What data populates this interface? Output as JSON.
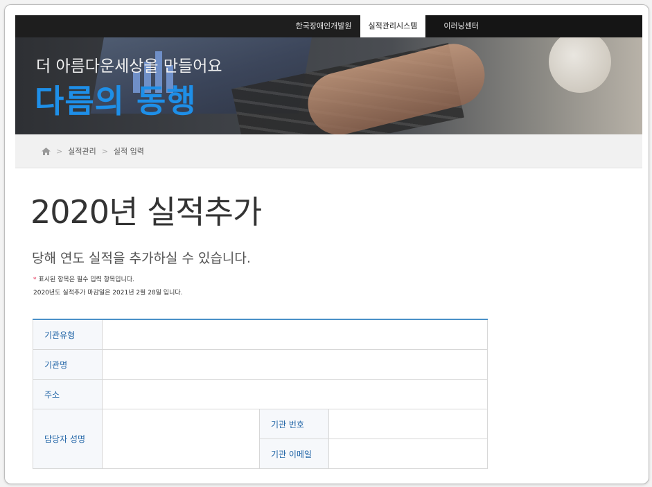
{
  "top_nav": {
    "items": [
      "한국장애인개발원",
      "실적관리시스템",
      "이러닝센터"
    ]
  },
  "hero": {
    "slogan": "더 아름다운세상을 만들어요",
    "brand": "다름의 동행"
  },
  "breadcrumb": {
    "home_icon": "home-icon",
    "items": [
      "실적관리",
      "실적 입력"
    ]
  },
  "page": {
    "title": "2020년 실적추가",
    "subtitle": "당해 연도 실적을 추가하실 수 있습니다.",
    "required_note": "표시된 항목은 필수 입력 항목입니다.",
    "deadline_note": "2020년도 실적추가 마감일은 2021년 2월 28일 입니다."
  },
  "form": {
    "org_type_label": "기관유형",
    "org_type_value": "",
    "org_name_label": "기관명",
    "org_name_value": "",
    "address_label": "주소",
    "address_value": "",
    "contact_name_label": "담당자 성명",
    "contact_name_value": "",
    "org_phone_label": "기관 번호",
    "org_phone_value": "",
    "org_email_label": "기관 이메일",
    "org_email_value": ""
  },
  "colors": {
    "brand_blue": "#1e8fe8",
    "label_blue": "#1f63a6",
    "table_border_top": "#4a90c8",
    "required_red": "#e0234a"
  }
}
